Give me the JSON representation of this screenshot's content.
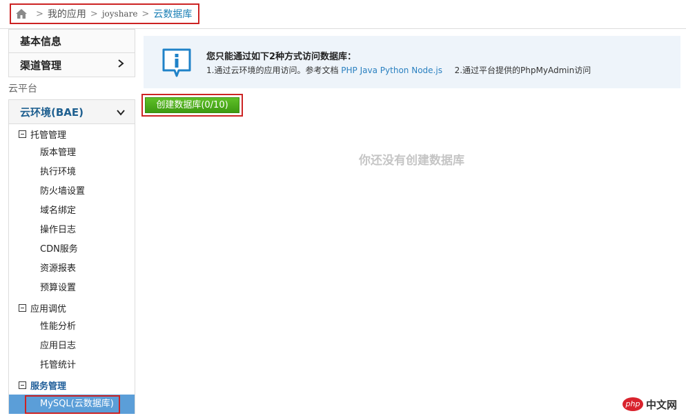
{
  "breadcrumb": {
    "home_icon": "home-icon",
    "items": [
      "我的应用",
      "joyshare",
      "云数据库"
    ]
  },
  "sidebar": {
    "top_items": [
      "基本信息",
      "渠道管理"
    ],
    "section_title": "云平台",
    "env_title": "云环境(BAE)",
    "groups": [
      {
        "title": "托管管理",
        "items": [
          "版本管理",
          "执行环境",
          "防火墙设置",
          "域名绑定",
          "操作日志",
          "CDN服务",
          "资源报表",
          "预算设置"
        ]
      },
      {
        "title": "应用调优",
        "items": [
          "性能分析",
          "应用日志",
          "托管统计"
        ]
      },
      {
        "title": "服务管理",
        "items": [
          "MySQL(云数据库)"
        ]
      }
    ]
  },
  "info": {
    "icon": "info-icon",
    "title": "您只能通过如下2种方式访问数据库：",
    "line_prefix": "1.通过云环境的应用访问。参考文档",
    "doc_links": [
      "PHP",
      "Java",
      "Python",
      "Node.js"
    ],
    "line_suffix": "2.通过平台提供的PhpMyAdmin访问"
  },
  "create_button": "创建数据库(0/10)",
  "empty_message": "你还没有创建数据库",
  "watermark": {
    "logo": "php",
    "text": "中文网"
  },
  "colors": {
    "accent_blue": "#1a7fb5",
    "button_green": "#4aa91a",
    "highlight_red": "#cc2222",
    "active_item": "#5b9ed8"
  }
}
